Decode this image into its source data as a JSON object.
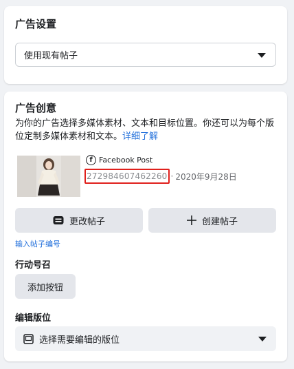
{
  "ad_settings": {
    "title": "广告设置",
    "post_select_value": "使用现有帖子"
  },
  "ad_creative": {
    "title": "广告创意",
    "description": "为你的广告选择多媒体素材、文本和目标位置。你还可以为每个版位定制多媒体素材和文本。",
    "learn_more": "详细了解",
    "post_type": "Facebook Post",
    "post_id": "272984607462260",
    "separator": "·",
    "post_date": "2020年9月28日",
    "change_post_label": "更改帖子",
    "create_post_label": "创建帖子",
    "enter_post_id_link": "输入帖子编号",
    "cta_label": "行动号召",
    "add_button_label": "添加按钮",
    "edit_placement_label": "编辑版位",
    "placement_select_value": "选择需要编辑的版位"
  },
  "icons": {
    "fb_icon": "facebook-circle-icon",
    "change_icon": "post-card-icon",
    "create_icon": "plus-icon",
    "placement_icon": "placement-square-icon",
    "caret": "caret-down-icon"
  },
  "colors": {
    "link": "#216fdb",
    "highlight": "#e0201c",
    "button_bg": "#e4e6eb"
  }
}
